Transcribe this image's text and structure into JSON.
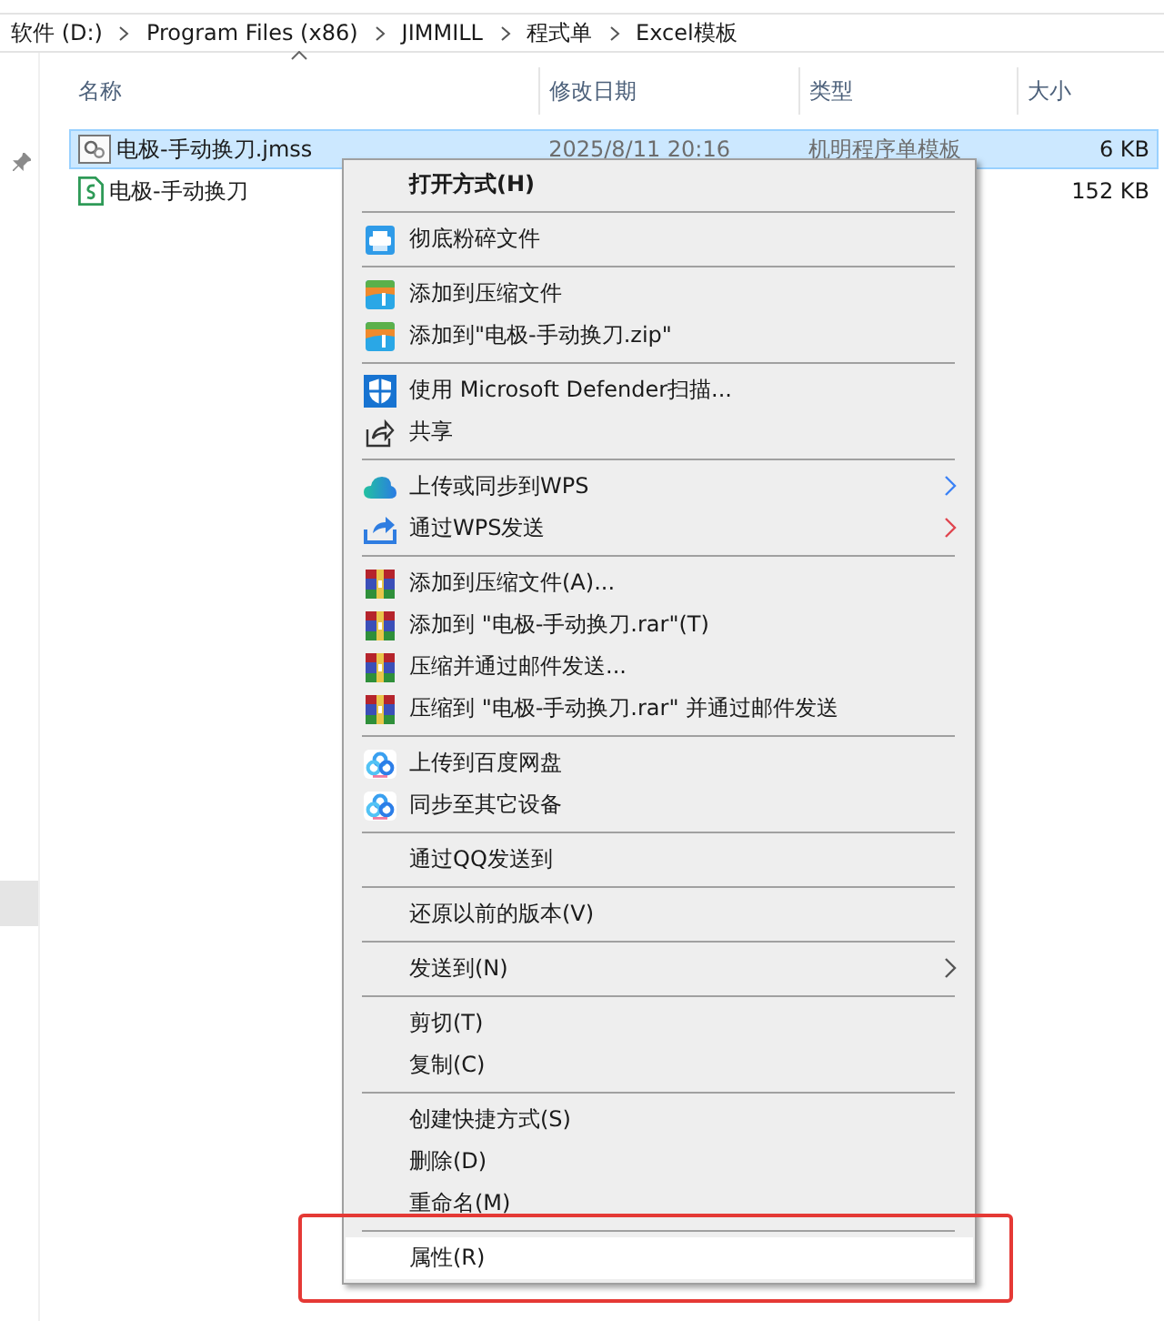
{
  "breadcrumb": [
    "软件 (D:)",
    "Program Files (x86)",
    "JIMMILL",
    "程式单",
    "Excel模板"
  ],
  "columns": [
    {
      "label": "名称",
      "sorted": true
    },
    {
      "label": "修改日期",
      "sorted": false
    },
    {
      "label": "类型",
      "sorted": false
    },
    {
      "label": "大小",
      "sorted": false
    }
  ],
  "files": [
    {
      "name": "电极-手动换刀.jmss",
      "modified": "2025/8/11 20:16",
      "type": "机明程序单模板",
      "size": "6 KB",
      "selected": true
    },
    {
      "name": "电极-手动换刀",
      "size": "152 KB",
      "selected": false
    }
  ],
  "context_menu": {
    "items": [
      {
        "kind": "item",
        "label": "打开方式(H)",
        "bold": true,
        "selected": false
      },
      {
        "kind": "separator"
      },
      {
        "kind": "item",
        "label": "彻底粉碎文件",
        "selected": false
      },
      {
        "kind": "separator"
      },
      {
        "kind": "item",
        "label": "添加到压缩文件",
        "selected": false
      },
      {
        "kind": "item",
        "label": "添加到\"电极-手动换刀.zip\"",
        "selected": false
      },
      {
        "kind": "separator"
      },
      {
        "kind": "item",
        "label": "使用 Microsoft Defender扫描...",
        "selected": false
      },
      {
        "kind": "item",
        "label": "共享",
        "selected": false
      },
      {
        "kind": "separator"
      },
      {
        "kind": "item",
        "label": "上传或同步到WPS",
        "submenu": true,
        "color": "#3b82f6",
        "selected": false
      },
      {
        "kind": "item",
        "label": "通过WPS发送",
        "submenu": true,
        "color": "#e0454f",
        "selected": false
      },
      {
        "kind": "separator"
      },
      {
        "kind": "item",
        "label": "添加到压缩文件(A)...",
        "selected": false
      },
      {
        "kind": "item",
        "label": "添加到 \"电极-手动换刀.rar\"(T)",
        "selected": false
      },
      {
        "kind": "item",
        "label": "压缩并通过邮件发送...",
        "selected": false
      },
      {
        "kind": "item",
        "label": "压缩到 \"电极-手动换刀.rar\" 并通过邮件发送",
        "selected": false
      },
      {
        "kind": "separator"
      },
      {
        "kind": "item",
        "label": "上传到百度网盘",
        "selected": false
      },
      {
        "kind": "item",
        "label": "同步至其它设备",
        "selected": false
      },
      {
        "kind": "separator"
      },
      {
        "kind": "item",
        "label": "通过QQ发送到",
        "selected": false
      },
      {
        "kind": "separator"
      },
      {
        "kind": "item",
        "label": "还原以前的版本(V)",
        "selected": false
      },
      {
        "kind": "separator"
      },
      {
        "kind": "item",
        "label": "发送到(N)",
        "submenu": true,
        "color": "#555555",
        "selected": false
      },
      {
        "kind": "separator"
      },
      {
        "kind": "item",
        "label": "剪切(T)",
        "selected": false
      },
      {
        "kind": "item",
        "label": "复制(C)",
        "selected": false
      },
      {
        "kind": "separator"
      },
      {
        "kind": "item",
        "label": "创建快捷方式(S)",
        "selected": false
      },
      {
        "kind": "item",
        "label": "删除(D)",
        "selected": false
      },
      {
        "kind": "item",
        "label": "重命名(M)",
        "selected": false
      },
      {
        "kind": "separator"
      },
      {
        "kind": "item",
        "label": "属性(R)",
        "selected": true
      }
    ]
  },
  "annotation": {
    "kind": "outline"
  }
}
